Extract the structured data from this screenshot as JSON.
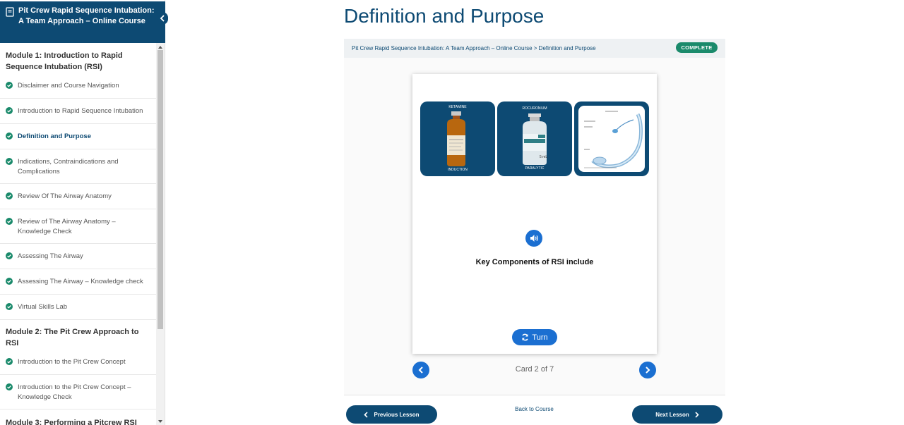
{
  "course": {
    "title": "Pit Crew Rapid Sequence Intubation: A Team Approach – Online Course"
  },
  "sidebar": {
    "modules": [
      {
        "title": "Module 1: Introduction to Rapid Sequence Intubation (RSI)",
        "lessons": [
          {
            "label": "Disclaimer and Course Navigation",
            "status": "complete"
          },
          {
            "label": "Introduction to Rapid Sequence Intubation",
            "status": "complete"
          },
          {
            "label": "Definition and Purpose",
            "status": "complete",
            "active": true
          },
          {
            "label": "Indications, Contraindications and Complications",
            "status": "complete"
          },
          {
            "label": "Review Of The Airway Anatomy",
            "status": "complete"
          },
          {
            "label": "Review of The Airway Anatomy – Knowledge Check",
            "status": "complete"
          },
          {
            "label": "Assessing The Airway",
            "status": "complete"
          },
          {
            "label": "Assessing The Airway – Knowledge check",
            "status": "complete"
          },
          {
            "label": "Virtual Skills Lab",
            "status": "complete"
          }
        ]
      },
      {
        "title": "Module 2: The Pit Crew Approach to RSI",
        "lessons": [
          {
            "label": "Introduction to the Pit Crew Concept",
            "status": "complete"
          },
          {
            "label": "Introduction to the Pit Crew Concept – Knowledge Check",
            "status": "complete"
          }
        ]
      },
      {
        "title": "Module 3: Performing a Pitcrew RSI",
        "lessons": []
      }
    ]
  },
  "page": {
    "title": "Definition and Purpose",
    "breadcrumb": "Pit Crew Rapid Sequence Intubation: A Team Approach – Online Course > Definition and Purpose",
    "status_badge": "COMPLETE"
  },
  "flashcard": {
    "images": [
      {
        "top_label": "KETAMINE",
        "bottom_label": "INDUCTION",
        "vial_color": "#b8670f"
      },
      {
        "top_label": "ROCURONIUM",
        "bottom_label": "PARALYTIC",
        "vial_color": "#dfe8ec"
      },
      {
        "top_label": "",
        "bottom_label": "",
        "vial_color": "#7fb4d8"
      }
    ],
    "vial2_text": "5 mL",
    "text": "Key Components of RSI include",
    "turn_label": "Turn",
    "counter": "Card 2 of 7",
    "current": 2,
    "total": 7
  },
  "footer": {
    "previous_label": "Previous Lesson",
    "back_label": "Back to Course",
    "next_label": "Next Lesson"
  },
  "colors": {
    "brand": "#0d4a73",
    "accent": "#1b6fd1",
    "success": "#1a8a6b"
  }
}
